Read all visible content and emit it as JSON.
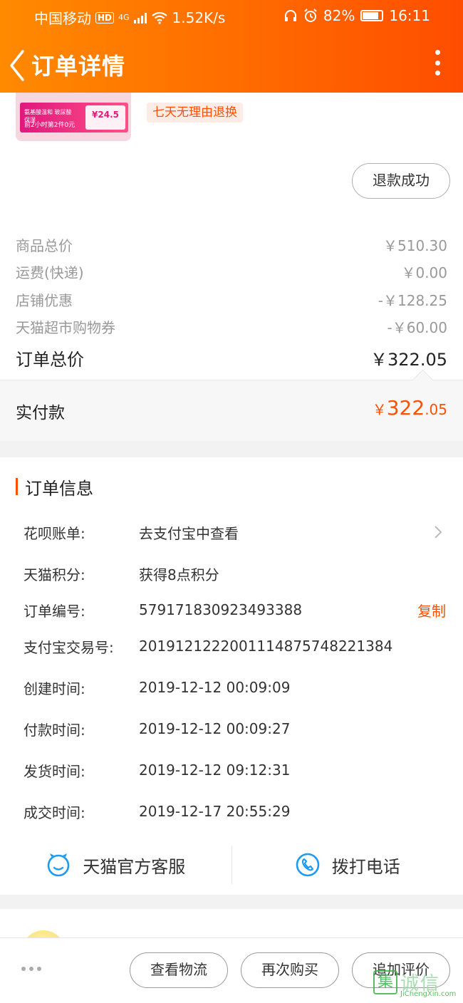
{
  "status_bar": {
    "carrier": "中国移动",
    "hd": "HD",
    "network": "4G",
    "speed": "1.52K/s",
    "battery": "82%",
    "time": "16:11"
  },
  "header": {
    "title": "订单详情"
  },
  "product": {
    "thumb_line1": "氨基酸温和 玻尿酸保湿",
    "thumb_line2": "前2小时第2件0元",
    "thumb_price": "¥24.5",
    "return_tag": "七天无理由退换",
    "refund_status": "退款成功"
  },
  "price_rows": [
    {
      "label": "商品总价",
      "value": "￥510.30"
    },
    {
      "label": "运费(快递)",
      "value": "￥0.00"
    },
    {
      "label": "店铺优惠",
      "value": "-￥128.25"
    },
    {
      "label": "天猫超市购物券",
      "value": "-￥60.00"
    }
  ],
  "order_total": {
    "label": "订单总价",
    "value": "￥322.05"
  },
  "paid": {
    "label": "实付款",
    "currency": "￥",
    "big": "322",
    "small": ".05"
  },
  "order_info": {
    "title": "订单信息",
    "rows": [
      {
        "label": "花呗账单:",
        "value": "去支付宝中查看"
      },
      {
        "label": "天猫积分:",
        "value": "获得8点积分"
      },
      {
        "label": "订单编号:",
        "value": "579171830923493388",
        "action": "复制"
      },
      {
        "label": "支付宝交易号:",
        "value": "2019121222001114875748221384"
      },
      {
        "label": "创建时间:",
        "value": "2019-12-12 00:09:09"
      },
      {
        "label": "付款时间:",
        "value": "2019-12-12 00:09:27"
      },
      {
        "label": "发货时间:",
        "value": "2019-12-12 09:12:31"
      },
      {
        "label": "成交时间:",
        "value": "2019-12-17 20:55:29"
      }
    ]
  },
  "service": {
    "customer_service": "天猫官方客服",
    "call": "拨打电话"
  },
  "actions": {
    "logistics": "查看物流",
    "rebuy": "再次购买",
    "review": "追加评价"
  },
  "watermark": {
    "char": "集",
    "cn": "诚信",
    "en": "JiChengXin.com"
  },
  "colors": {
    "accent": "#ff5000",
    "header_start": "#ff8a00",
    "header_end": "#ff4d00"
  }
}
